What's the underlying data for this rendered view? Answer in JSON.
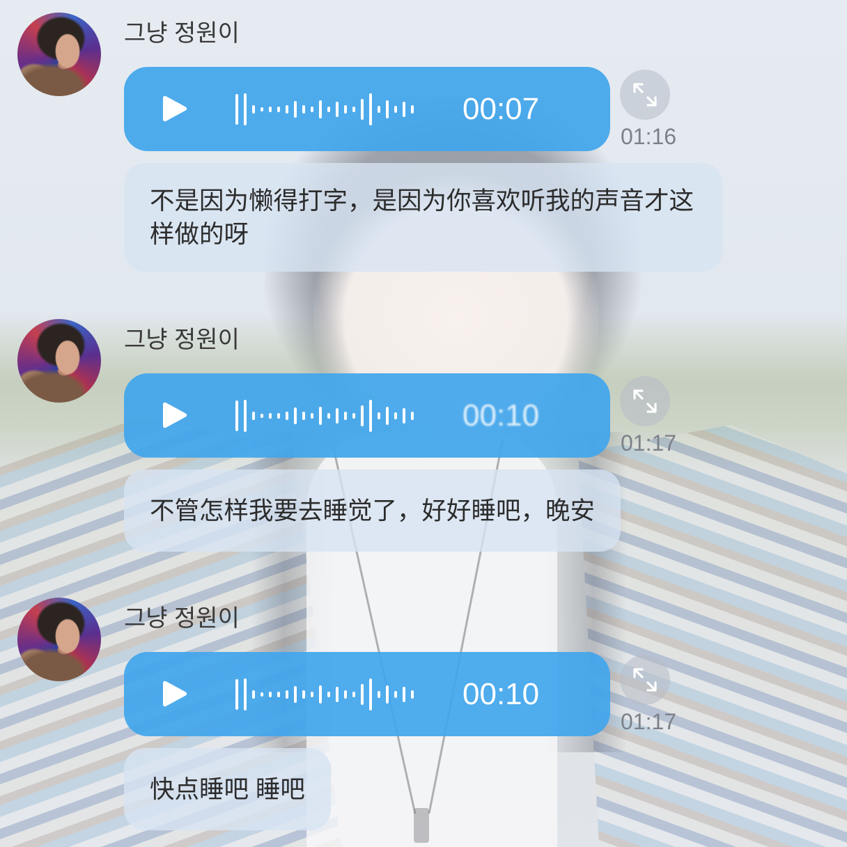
{
  "chat": {
    "messages": [
      {
        "sender": "그냥 정원이",
        "voice_duration": "00:07",
        "timestamp": "01:16",
        "translation": "不是因为懒得打字，是因为你喜欢听我的声音才这样做的呀"
      },
      {
        "sender": "그냥 정원이",
        "voice_duration": "00:10",
        "timestamp": "01:17",
        "translation": "不管怎样我要去睡觉了，好好睡吧，晚安"
      },
      {
        "sender": "그냥 정원이",
        "voice_duration": "00:10",
        "timestamp": "01:17",
        "translation": "快点睡吧 睡吧"
      }
    ]
  },
  "icons": {
    "avatar": "user-avatar",
    "play": "play-icon",
    "waveform": "audio-waveform-icon",
    "expand": "expand-icon"
  },
  "colors": {
    "voice_bubble": "#42a6ec",
    "translation_bubble": "#d7e4f2",
    "text": "#2c2c2c",
    "timestamp": "#7c8189"
  }
}
